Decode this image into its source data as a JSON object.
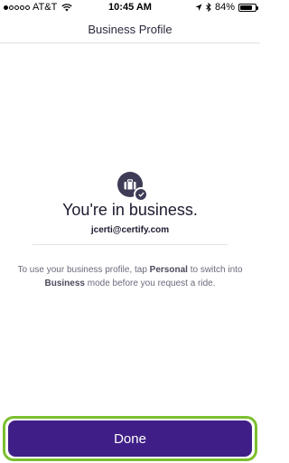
{
  "status_bar": {
    "carrier": "AT&T",
    "time": "10:45 AM",
    "battery": "84%",
    "battery_level": 0.84,
    "signal_bars_filled": 1,
    "signal_bars_total": 5,
    "icons": [
      "wifi-icon",
      "location-arrow-icon",
      "bluetooth-icon",
      "battery-icon"
    ]
  },
  "nav": {
    "title": "Business Profile"
  },
  "main": {
    "icon": "briefcase-icon",
    "badge_icon": "checkmark-icon",
    "headline": "You're in business.",
    "email": "jcerti@certify.com",
    "info_part1": "To use your business profile, tap ",
    "info_bold1": "Personal",
    "info_part2": " to switch into ",
    "info_bold2": "Business",
    "info_part3": " mode before you request a ride."
  },
  "footer": {
    "done_label": "Done"
  },
  "colors": {
    "accent": "#3f1f87",
    "highlight": "#7cbf2f",
    "icon_bg": "#3d3b55",
    "text": "#1c1a2e",
    "muted": "#6b6a7b"
  }
}
